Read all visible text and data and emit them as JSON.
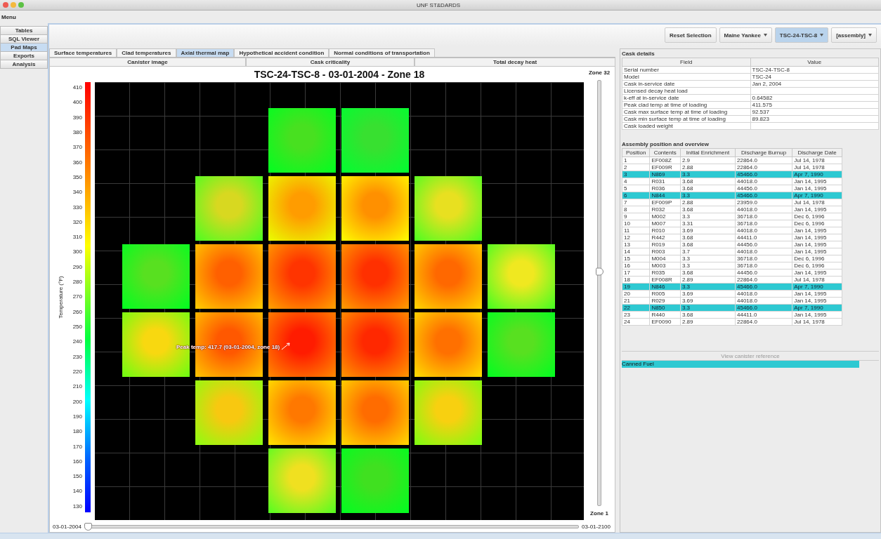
{
  "window": {
    "title": "UNF ST&DARDS"
  },
  "menu": {
    "label": "Menu"
  },
  "nav": [
    {
      "label": "Tables",
      "selected": false
    },
    {
      "label": "SQL Viewer",
      "selected": false
    },
    {
      "label": "Pad Maps",
      "selected": true
    },
    {
      "label": "Exports",
      "selected": false
    },
    {
      "label": "Analysis",
      "selected": false
    }
  ],
  "toolbar": {
    "reset_button": "Reset Selection",
    "dropdowns": [
      {
        "label": "Maine Yankee",
        "selected": false
      },
      {
        "label": "TSC-24-TSC-8",
        "selected": true
      },
      {
        "label": "[assembly]",
        "selected": false
      }
    ]
  },
  "tabs": [
    {
      "label": "Surface temperatures",
      "selected": false
    },
    {
      "label": "Clad temperatures",
      "selected": false
    },
    {
      "label": "Axial thermal map",
      "selected": true
    },
    {
      "label": "Hypothetical accident condition",
      "selected": false
    },
    {
      "label": "Normal conditions of transportation",
      "selected": false
    }
  ],
  "subtabs": [
    {
      "label": "Canister image",
      "selected": false
    },
    {
      "label": "Cask criticality",
      "selected": false
    },
    {
      "label": "Total decay heat",
      "selected": false
    }
  ],
  "chart": {
    "title": "TSC-24-TSC-8 - 03-01-2004 - Zone 18",
    "ylabel": "Temperature (°F)",
    "colorbar_ticks": [
      "410",
      "400",
      "390",
      "380",
      "370",
      "360",
      "350",
      "340",
      "330",
      "320",
      "310",
      "300",
      "290",
      "280",
      "270",
      "260",
      "250",
      "240",
      "230",
      "220",
      "210",
      "200",
      "190",
      "180",
      "170",
      "160",
      "150",
      "140",
      "130"
    ],
    "map_rows": [
      {
        "cells": [
          {
            "kind": "empty"
          },
          {
            "kind": "empty"
          },
          {
            "kind": "assembly",
            "color": "#48e020"
          },
          {
            "kind": "assembly",
            "color": "#38e030"
          },
          {
            "kind": "empty"
          },
          {
            "kind": "empty"
          }
        ]
      },
      {
        "cells": [
          {
            "kind": "empty"
          },
          {
            "kind": "assembly",
            "color": "#d8d820"
          },
          {
            "kind": "assembly",
            "color": "#ff9c00"
          },
          {
            "kind": "assembly",
            "color": "#ff9000"
          },
          {
            "kind": "assembly",
            "color": "#e8e020"
          },
          {
            "kind": "empty"
          }
        ]
      },
      {
        "cells": [
          {
            "kind": "assembly",
            "color": "#58e020"
          },
          {
            "kind": "assembly",
            "color": "#ff6000"
          },
          {
            "kind": "assembly",
            "color": "#ff3400"
          },
          {
            "kind": "assembly",
            "color": "#ff3000"
          },
          {
            "kind": "assembly",
            "color": "#ff6800"
          },
          {
            "kind": "assembly",
            "color": "#f0e820"
          }
        ]
      },
      {
        "cells": [
          {
            "kind": "assembly",
            "color": "#f8d810"
          },
          {
            "kind": "assembly",
            "color": "#ff5800"
          },
          {
            "kind": "assembly",
            "color": "#ff1c00"
          },
          {
            "kind": "assembly",
            "color": "#ff2800"
          },
          {
            "kind": "assembly",
            "color": "#ff7000"
          },
          {
            "kind": "assembly",
            "color": "#58e020"
          }
        ]
      },
      {
        "cells": [
          {
            "kind": "empty"
          },
          {
            "kind": "assembly",
            "color": "#f8c810"
          },
          {
            "kind": "assembly",
            "color": "#ff7800"
          },
          {
            "kind": "assembly",
            "color": "#ff6c00"
          },
          {
            "kind": "assembly",
            "color": "#f8d010"
          },
          {
            "kind": "empty"
          }
        ]
      },
      {
        "cells": [
          {
            "kind": "empty"
          },
          {
            "kind": "empty"
          },
          {
            "kind": "assembly",
            "color": "#f0e020"
          },
          {
            "kind": "assembly",
            "color": "#40e020"
          },
          {
            "kind": "empty"
          },
          {
            "kind": "empty"
          }
        ]
      }
    ],
    "annotation": "Peak temp: 417.7 (03-01-2004, zone 18)",
    "zone_slider": {
      "top_label": "Zone 32",
      "bottom_label": "Zone 1",
      "level": 0.55
    },
    "time_slider": {
      "start_label": "03-01-2004",
      "end_label": "03-01-2100",
      "level": 0
    }
  },
  "cask_details": {
    "title": "Cask details",
    "columns": [
      "Field",
      "Value"
    ],
    "rows": [
      {
        "field": "Serial number",
        "value": "TSC-24-TSC-8"
      },
      {
        "field": "Model",
        "value": "TSC-24"
      },
      {
        "field": "Cask in-service date",
        "value": "Jan 2, 2004"
      },
      {
        "field": "Licensed decay heat load"
      },
      {
        "field": "k-eff at in-service date",
        "value": "0.64582"
      },
      {
        "field": "Peak clad temp at time of loading",
        "value": "411.575"
      },
      {
        "field": "Cask max surface temp at time of loading",
        "value": "92.537"
      },
      {
        "field": "Cask min surface temp at time of loading",
        "value": "89.823"
      },
      {
        "field": "Cask loaded weight"
      }
    ]
  },
  "assemblies": {
    "title": "Assembly position and overview",
    "columns": [
      "Position",
      "Contents",
      "Initial Enrichment",
      "Discharge Burnup",
      "Discharge Date"
    ],
    "rows": [
      {
        "cells": [
          "1",
          "EF008Z",
          "2.9",
          "22864.0",
          "Jul 14, 1978"
        ],
        "selected": false
      },
      {
        "cells": [
          "2",
          "EF009R",
          "2.88",
          "22864.0",
          "Jul 14, 1978"
        ],
        "selected": false
      },
      {
        "cells": [
          "3",
          "N869",
          "3.3",
          "45466.0",
          "Apr 7, 1990"
        ],
        "selected": true
      },
      {
        "cells": [
          "4",
          "R031",
          "3.68",
          "44018.0",
          "Jan 14, 1995"
        ],
        "selected": false
      },
      {
        "cells": [
          "5",
          "R036",
          "3.68",
          "44456.0",
          "Jan 14, 1995"
        ],
        "selected": false
      },
      {
        "cells": [
          "6",
          "N844",
          "3.3",
          "45466.0",
          "Apr 7, 1990"
        ],
        "selected": true
      },
      {
        "cells": [
          "7",
          "EF009P",
          "2.88",
          "23959.0",
          "Jul 14, 1978"
        ],
        "selected": false
      },
      {
        "cells": [
          "8",
          "R032",
          "3.68",
          "44018.0",
          "Jan 14, 1995"
        ],
        "selected": false
      },
      {
        "cells": [
          "9",
          "M002",
          "3.3",
          "36718.0",
          "Dec 6, 1996"
        ],
        "selected": false
      },
      {
        "cells": [
          "10",
          "M007",
          "3.31",
          "36718.0",
          "Dec 6, 1996"
        ],
        "selected": false
      },
      {
        "cells": [
          "11",
          "R010",
          "3.69",
          "44018.0",
          "Jan 14, 1995"
        ],
        "selected": false
      },
      {
        "cells": [
          "12",
          "R442",
          "3.68",
          "44411.0",
          "Jan 14, 1995"
        ],
        "selected": false
      },
      {
        "cells": [
          "13",
          "R019",
          "3.68",
          "44456.0",
          "Jan 14, 1995"
        ],
        "selected": false
      },
      {
        "cells": [
          "14",
          "R003",
          "3.7",
          "44018.0",
          "Jan 14, 1995"
        ],
        "selected": false
      },
      {
        "cells": [
          "15",
          "M004",
          "3.3",
          "36718.0",
          "Dec 6, 1996"
        ],
        "selected": false
      },
      {
        "cells": [
          "16",
          "M003",
          "3.3",
          "36718.0",
          "Dec 6, 1996"
        ],
        "selected": false
      },
      {
        "cells": [
          "17",
          "R035",
          "3.68",
          "44456.0",
          "Jan 14, 1995"
        ],
        "selected": false
      },
      {
        "cells": [
          "18",
          "EF008R",
          "2.89",
          "22864.0",
          "Jul 14, 1978"
        ],
        "selected": false
      },
      {
        "cells": [
          "19",
          "N846",
          "3.3",
          "45466.0",
          "Apr 7, 1990"
        ],
        "selected": true
      },
      {
        "cells": [
          "20",
          "R005",
          "3.69",
          "44018.0",
          "Jan 14, 1995"
        ],
        "selected": false
      },
      {
        "cells": [
          "21",
          "R029",
          "3.69",
          "44018.0",
          "Jan 14, 1995"
        ],
        "selected": false
      },
      {
        "cells": [
          "22",
          "N850",
          "3.3",
          "45466.0",
          "Apr 7, 1990"
        ],
        "selected": true
      },
      {
        "cells": [
          "23",
          "R440",
          "3.68",
          "44411.0",
          "Jan 14, 1995"
        ],
        "selected": false
      },
      {
        "cells": [
          "24",
          "EF0090",
          "2.89",
          "22864.0",
          "Jul 14, 1978"
        ],
        "selected": false
      }
    ]
  },
  "canister_button": {
    "label": "View canister reference",
    "disabled": true
  },
  "fuel_list": [
    {
      "label": "Canned Fuel",
      "selected": true
    }
  ]
}
